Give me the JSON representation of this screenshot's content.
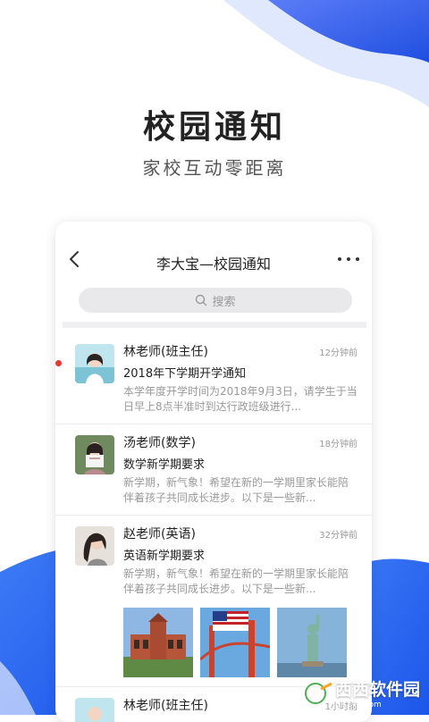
{
  "hero": {
    "title": "校园通知",
    "subtitle": "家校互动零距离"
  },
  "nav": {
    "title": "李大宝—校园通知"
  },
  "search": {
    "placeholder": "搜索"
  },
  "messages": [
    {
      "sender": "林老师(班主任)",
      "time": "12分钟前",
      "subject": "2018年下学期开学通知",
      "preview": "本学年度开学时间为2018年9月3日，请学生于当日早上8点半准时到达行政班级进行...",
      "unread": true
    },
    {
      "sender": "汤老师(数学)",
      "time": "18分钟前",
      "subject": "数学新学期要求",
      "preview": "新学期，新气象！希望在新的一学期里家长能陪伴着孩子共同成长进步。以下是一些新..."
    },
    {
      "sender": "赵老师(英语)",
      "time": "32分钟前",
      "subject": "英语新学期要求",
      "preview": "新学期，新气象！希望在新的一学期里家长能陪伴着孩子共同成长进步。以下是一些新..."
    },
    {
      "sender": "林老师(班主任)",
      "time": "1小时前"
    }
  ],
  "watermark": {
    "text": "西西软件园",
    "sub": "CR173.com"
  },
  "colors": {
    "accent_blue": "#2f6cf4",
    "unread_red": "#e53935"
  }
}
